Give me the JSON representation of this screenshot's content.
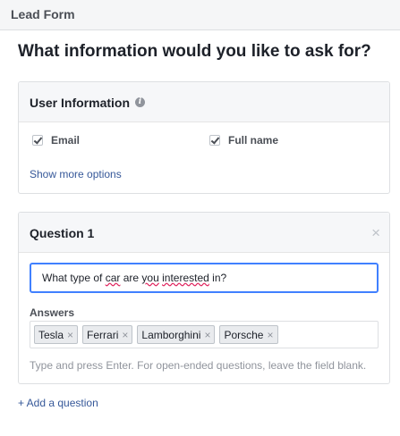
{
  "header": {
    "title": "Lead Form"
  },
  "page": {
    "question": "What information would you like to ask for?"
  },
  "user_info": {
    "title": "User Information",
    "fields": [
      {
        "label": "Email",
        "checked": true
      },
      {
        "label": "Full name",
        "checked": true
      }
    ],
    "more_link": "Show more options"
  },
  "question1": {
    "title": "Question 1",
    "close_glyph": "×",
    "input_words": [
      "What type of",
      "car",
      "are",
      "you",
      "interested",
      "in?"
    ],
    "answers_label": "Answers",
    "answers": [
      "Tesla",
      "Ferrari",
      "Lamborghini",
      "Porsche"
    ],
    "tag_remove_glyph": "×",
    "hint": "Type and press Enter. For open-ended questions, leave the field blank."
  },
  "add_question": "+ Add a question",
  "icons": {
    "info": "info-icon",
    "check": "check-icon",
    "close": "close-icon"
  },
  "colors": {
    "accent": "#4080ff",
    "link": "#365899",
    "spellcheck": "#e0245e"
  }
}
